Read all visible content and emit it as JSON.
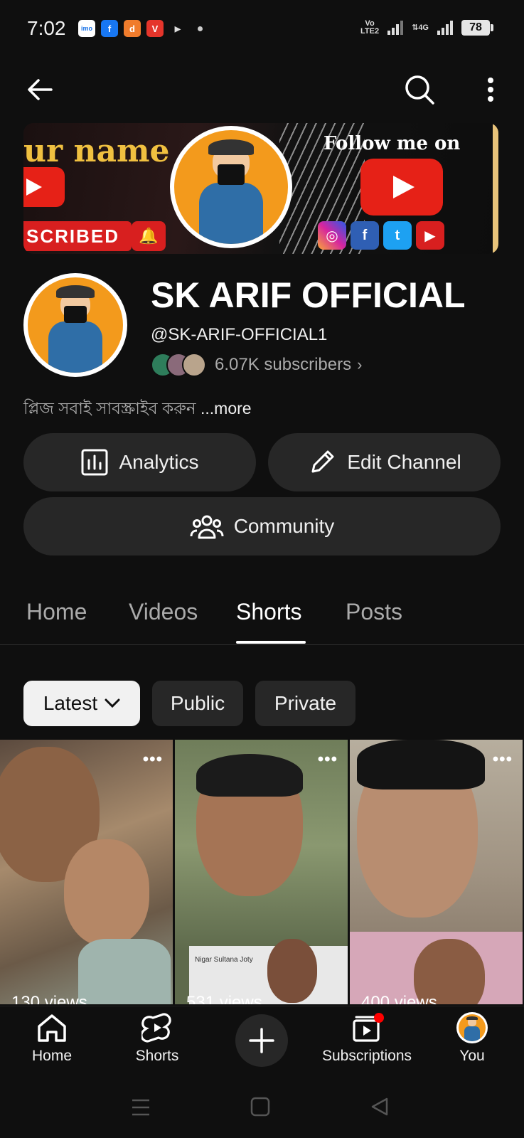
{
  "status_bar": {
    "time": "7:02",
    "apps": [
      "imo",
      "f",
      "d",
      "V",
      "inshot"
    ],
    "network": "Vo LTE2",
    "network_type": "4G",
    "battery": "78"
  },
  "banner": {
    "text_name_part": "ur name",
    "text_subscribed": "SCRIBED",
    "text_follow": "Follow me on",
    "socials": [
      "instagram",
      "facebook",
      "twitter",
      "youtube"
    ]
  },
  "channel": {
    "name": "SK ARIF OFFICIAL",
    "handle": "@SK-ARIF-OFFICIAL1",
    "subscribers": "6.07K subscribers",
    "description": "প্লিজ সবাই সাবস্ক্রাইব করুন",
    "more_label": " ...more"
  },
  "actions": {
    "analytics": "Analytics",
    "edit_channel": "Edit Channel",
    "community": "Community"
  },
  "tabs": [
    {
      "label": "Home",
      "active": false
    },
    {
      "label": "Videos",
      "active": false
    },
    {
      "label": "Shorts",
      "active": true
    },
    {
      "label": "Posts",
      "active": false
    }
  ],
  "chips": [
    {
      "label": "Latest",
      "selected": true
    },
    {
      "label": "Public",
      "selected": false
    },
    {
      "label": "Private",
      "selected": false
    }
  ],
  "shorts": [
    {
      "views": "130 views",
      "overlay": ""
    },
    {
      "views": "531 views",
      "overlay": "Nigar Sultana Joty"
    },
    {
      "views": "400 views",
      "overlay": ""
    }
  ],
  "bottom_nav": {
    "home": "Home",
    "shorts": "Shorts",
    "subscriptions": "Subscriptions",
    "you": "You"
  },
  "colors": {
    "background": "#0f0f0f",
    "surface": "#272727",
    "accent_red": "#ff0000",
    "avatar_orange": "#f39a1c"
  }
}
